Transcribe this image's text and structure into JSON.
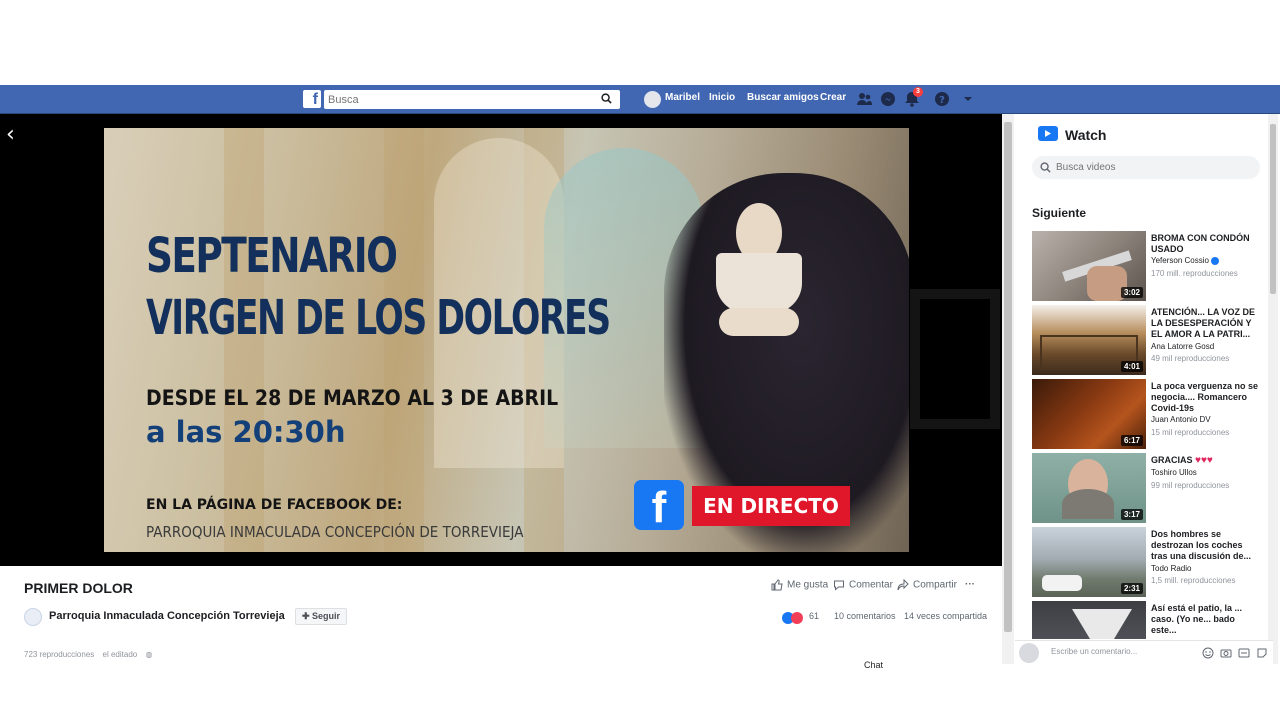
{
  "topbar": {
    "search_placeholder": "Busca",
    "user_name": "Maribel",
    "home_label": "Inicio",
    "find_friends_label": "Buscar amigos",
    "create_label": "Crear",
    "notifications_count": "3",
    "brand_color": "#4267b2"
  },
  "video": {
    "line1": "SEPTENARIO",
    "line2": "VIRGEN DE LOS DOLORES",
    "dates": "DESDE EL 28 DE MARZO AL 3 DE ABRIL",
    "time": "a las 20:30h",
    "page_intro": "EN LA PÁGINA DE FACEBOOK DE:",
    "parish": "PARROQUIA INMACULADA CONCEPCIÓN DE TORREVIEJA",
    "live_label": "EN DIRECTO",
    "fb_letter": "f"
  },
  "post": {
    "title": "PRIMER DOLOR",
    "page_name": "Parroquia Inmaculada Concepción Torrevieja",
    "follow_label": "Seguir",
    "like_label": "Me gusta",
    "comment_label": "Comentar",
    "share_label": "Compartir",
    "more_label": "···",
    "reaction_count": "61",
    "comments_count": "10 comentarios",
    "shares_count": "14 veces compartida",
    "views_text": "723 reproducciones",
    "edited_text": "el editado",
    "chat_label": "Chat"
  },
  "watch": {
    "title": "Watch",
    "search_placeholder": "Busca videos",
    "up_next_label": "Siguiente",
    "suggestions": [
      {
        "title": "BROMA CON CONDÓN USADO",
        "author": "Yeferson Cossio",
        "verified": true,
        "views": "170 mill. reproducciones",
        "duration": "3:02"
      },
      {
        "title": "ATENCIÓN... LA VOZ DE LA DESESPERACIÓN Y EL AMOR A LA PATRI...",
        "author": "Ana Latorre Gosd",
        "verified": false,
        "views": "49 mil reproducciones",
        "duration": "4:01"
      },
      {
        "title": "La poca verguenza no se negocia.... Romancero Covid-19s",
        "author": "Juan Antonio DV",
        "verified": false,
        "views": "15 mil reproducciones",
        "duration": "6:17"
      },
      {
        "title": "GRACIAS",
        "author": "Toshiro Ullos",
        "verified": false,
        "views": "99 mil reproducciones",
        "duration": "3:17"
      },
      {
        "title": "Dos hombres se destrozan los coches tras una discusión de...",
        "author": "Todo Radio",
        "verified": false,
        "views": "1,5 mill. reproducciones",
        "duration": "2:31"
      },
      {
        "title": "Así está el patio, la ... caso. (Yo ne... bado este...",
        "author": "",
        "verified": false,
        "views": "",
        "duration": ""
      }
    ],
    "comment_placeholder": "Escribe un comentario..."
  }
}
